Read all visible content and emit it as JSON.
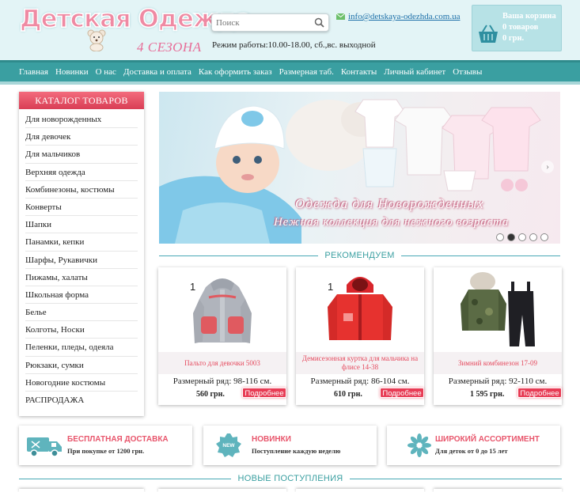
{
  "header": {
    "logo_text": "Детская Одежда",
    "logo_subtitle": "4 СЕЗОНА",
    "search_placeholder": "Поиск",
    "email": "info@detskaya-odezhda.com.ua",
    "hours": "Режим работы:10.00-18.00, сб.,вс. выходной",
    "cart": {
      "title": "Ваша корзина",
      "items": "0 товаров",
      "total": "0 грн."
    }
  },
  "nav": [
    "Главная",
    "Новинки",
    "О нас",
    "Доставка и оплата",
    "Как оформить заказ",
    "Размерная таб.",
    "Контакты",
    "Личный кабинет",
    "Отзывы"
  ],
  "catalog": {
    "title": "КАТАЛОГ ТОВАРОВ",
    "items": [
      "Для новорожденных",
      "Для девочек",
      "Для мальчиков",
      "Верхняя одежда",
      "Комбинезоны, костюмы",
      "Конверты",
      "Шапки",
      "Панамки, кепки",
      "Шарфы, Рукавички",
      "Пижамы, халаты",
      "Школьная форма",
      "Белье",
      "Колготы, Носки",
      "Пеленки, пледы, одеяла",
      "Рюкзаки, сумки",
      "Новогодние костюмы",
      "РАСПРОДАЖА"
    ]
  },
  "banner": {
    "title": "Одежда для Новорожденных",
    "subtitle": "Нежная коллекция для нежного возраста",
    "slides": 5,
    "active_slide": 2
  },
  "recommend": {
    "heading": "РЕКОМЕНДУЕМ",
    "products": [
      {
        "badge": "1",
        "name": "Пальто для девочки 5003",
        "size": "Размерный ряд: 98-116 см.",
        "price": "560 грн.",
        "more": "Подробнее"
      },
      {
        "badge": "1",
        "name": "Демисезонная куртка для мальчика на флисе 14-38",
        "size": "Размерный ряд: 86-104 см.",
        "price": "610 грн.",
        "more": "Подробнее"
      },
      {
        "badge": "",
        "name": "Зимний комбинезон 17-09",
        "size": "Размерный ряд: 92-110 см.",
        "price": "1 595 грн.",
        "more": "Подробнее"
      }
    ]
  },
  "features": [
    {
      "icon": "delivery-truck-icon",
      "title": "БЕСПЛАТНАЯ ДОСТАВКА",
      "subtitle": "При покупке от 1200 грн."
    },
    {
      "icon": "new-badge-icon",
      "title": "НОВИНКИ",
      "subtitle": "Поступление каждую неделю"
    },
    {
      "icon": "assortment-flower-icon",
      "title": "ШИРОКИЙ АССОРТИМЕНТ",
      "subtitle": "Для деток от 0 до 15 лет"
    }
  ],
  "new_arrivals": {
    "heading": "НОВЫЕ ПОСТУПЛЕНИЯ"
  },
  "colors": {
    "accent": "#3a9fa1",
    "pink": "#e8566c",
    "header_bg": "#e3f4f6"
  }
}
